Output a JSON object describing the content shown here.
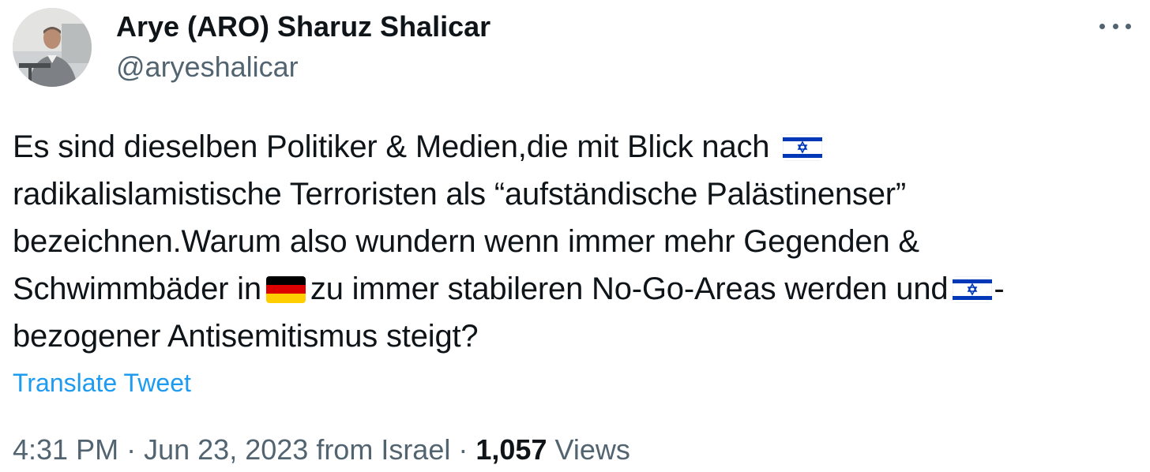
{
  "author": {
    "display_name": "Arye (ARO) Sharuz Shalicar",
    "handle": "@aryeshalicar",
    "avatar_icon": "profile-photo"
  },
  "menu": {
    "more_icon": "more-horizontal-icon"
  },
  "tweet": {
    "lines": [
      "Es sind dieselben Politiker & Medien,die mit Blick nach",
      "radikalislamistische Terroristen als “aufständische Palästinenser”",
      "bezeichnen.Warum also wundern wenn immer mehr Gegenden &",
      "Schwimmbäder in",
      "zu immer stabileren No-Go-Areas werden und",
      "-",
      "bezogener Antisemitismus steigt?"
    ],
    "flags": [
      "flag-israel",
      "flag-germany",
      "flag-israel"
    ],
    "translate_label": "Translate Tweet"
  },
  "meta": {
    "time": "4:31 PM",
    "separator": "·",
    "date": "Jun 23, 2023",
    "location": "from Israel",
    "views_count": "1,057",
    "views_label": "Views"
  },
  "colors": {
    "text": "#0f1419",
    "secondary": "#536471",
    "link": "#1d9bf0",
    "israel_blue": "#0038b8"
  }
}
